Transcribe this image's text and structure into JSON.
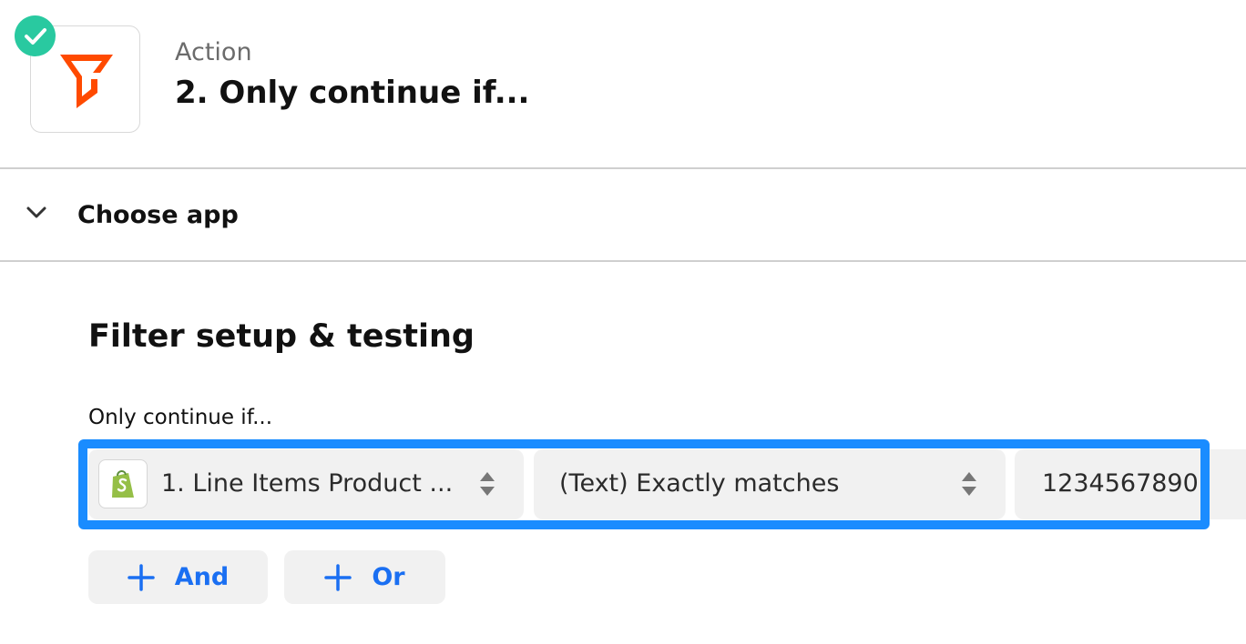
{
  "header": {
    "step_type": "Action",
    "step_title": "2. Only continue if...",
    "app_icon": "filter-icon",
    "status_icon": "check-icon",
    "colors": {
      "filter_icon": "#ff4a00",
      "status_badge": "#29c9a0"
    }
  },
  "choose_app": {
    "label": "Choose app",
    "toggle_icon": "chevron-down-icon"
  },
  "filter_setup": {
    "heading": "Filter setup & testing",
    "field_label": "Only continue if...",
    "rule": {
      "field_icon": "shopify-icon",
      "field_value": "1. Line Items Product ...",
      "condition_value": "(Text) Exactly matches",
      "value": "1234567890",
      "select_icon": "sort-arrows-icon"
    },
    "buttons": {
      "and_label": "And",
      "or_label": "Or",
      "icon": "plus-icon"
    },
    "colors": {
      "highlight": "#1a8cff",
      "button_text": "#1a6ff2"
    }
  }
}
